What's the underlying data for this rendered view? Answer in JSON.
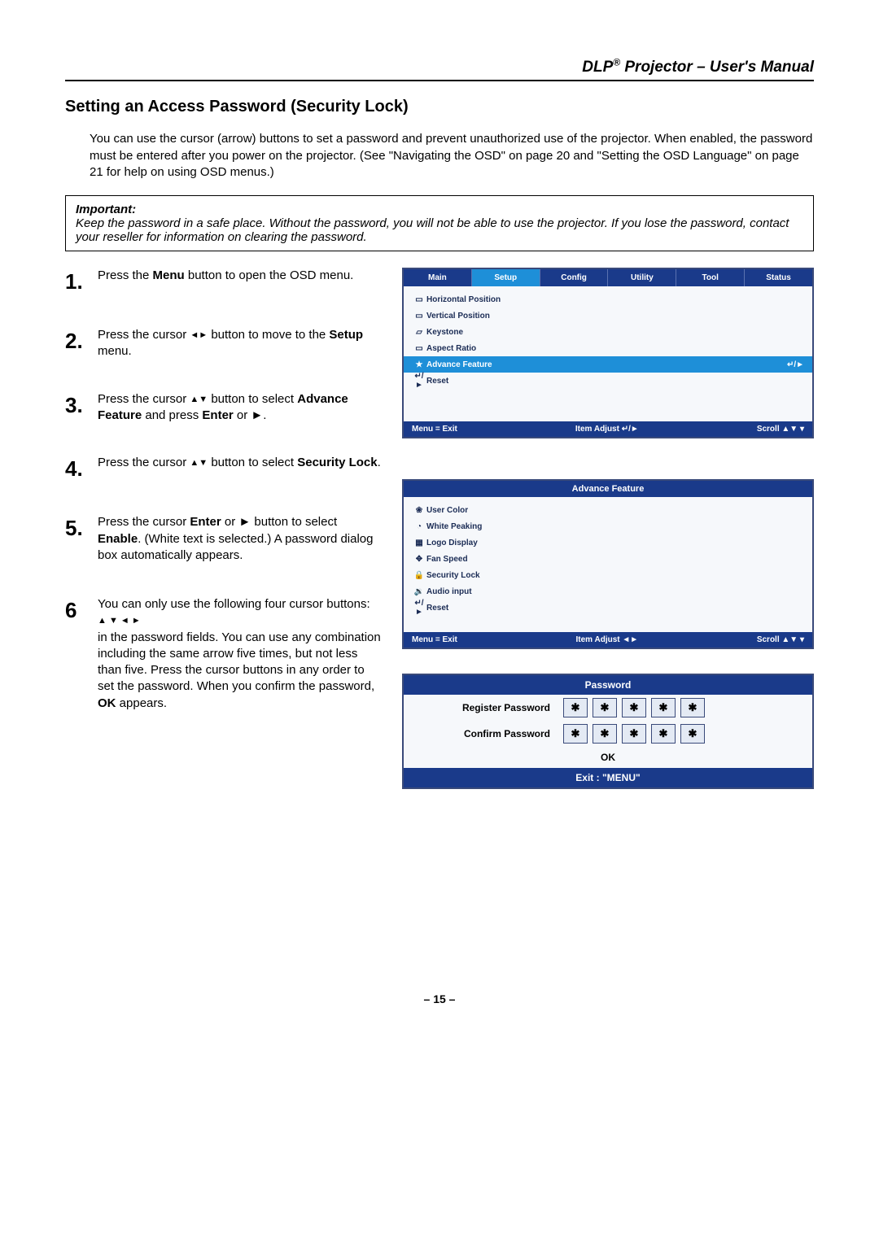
{
  "header": {
    "title_prefix": "DLP",
    "title_suffix": " Projector – User's Manual"
  },
  "section_title": "Setting an Access Password (Security Lock)",
  "intro": "You can use the cursor (arrow) buttons to set a password and prevent unauthorized use of the projector. When enabled, the password must be entered after you power on the projector. (See \"Navigating the OSD\" on page 20 and \"Setting the OSD Language\" on page 21 for help on using OSD menus.)",
  "important": {
    "label": "Important:",
    "body": "Keep the password in a safe place. Without the password, you will not be able to use the projector. If you lose the password, contact your reseller for information on clearing the password."
  },
  "steps": [
    {
      "num": "1.",
      "text_a": "Press the ",
      "b1": "Menu",
      "text_b": " button to open the OSD menu."
    },
    {
      "num": "2.",
      "text_a": "Press the cursor ",
      "arrows": "◄►",
      "text_b": " button to move to the ",
      "b1": "Setup",
      "text_c": " menu."
    },
    {
      "num": "3.",
      "text_a": "Press the cursor ",
      "arrows": "▲▼",
      "text_b": " button to select ",
      "b1": "Advance Feature",
      "text_c": " and press ",
      "b2": "Enter",
      "text_d": " or ►."
    },
    {
      "num": "4.",
      "text_a": "Press the cursor ",
      "arrows": "▲▼",
      "text_b": " button to select ",
      "b1": "Security Lock",
      "text_c": "."
    },
    {
      "num": "5.",
      "text_a": "Press the cursor ",
      "b1": "Enter",
      "text_b": " or ► button to select ",
      "b2": "Enable",
      "text_c": ". (White text is selected.) A password dialog box automatically appears."
    },
    {
      "num": "6",
      "text_a": "You can only use the following four cursor buttons: ",
      "arrows": "▲ ▼ ◄ ►",
      "text_b": " in the password fields. You can use any combination including the same arrow five times, but not less than five. Press the cursor buttons in any order to set the password. When you confirm the password, ",
      "b1": "OK",
      "text_c": " appears."
    }
  ],
  "osd1": {
    "tabs": [
      "Main",
      "Setup",
      "Config",
      "Utility",
      "Tool",
      "Status"
    ],
    "selected_tab": "Setup",
    "items": [
      {
        "icon": "▭",
        "label": "Horizontal Position"
      },
      {
        "icon": "▭",
        "label": "Vertical Position"
      },
      {
        "icon": "▱",
        "label": "Keystone"
      },
      {
        "icon": "▭",
        "label": "Aspect Ratio"
      },
      {
        "icon": "★",
        "label": "Advance Feature",
        "highlight": true,
        "extra": "↵/►"
      },
      {
        "icon": "↵/►",
        "label": "Reset"
      }
    ],
    "footer_left": "Menu = Exit",
    "footer_mid": "Item Adjust  ↵/►",
    "footer_right": "Scroll  ▲▼  ▾"
  },
  "osd2": {
    "title": "Advance Feature",
    "items": [
      {
        "icon": "❀",
        "label": "User Color"
      },
      {
        "icon": "◔",
        "label": "White Peaking"
      },
      {
        "icon": "▦",
        "label": "Logo Display"
      },
      {
        "icon": "✥",
        "label": "Fan Speed"
      },
      {
        "icon": "🔒",
        "label": "Security Lock"
      },
      {
        "icon": "🔉",
        "label": "Audio input"
      },
      {
        "icon": "↵/►",
        "label": "Reset"
      }
    ],
    "footer_left": "Menu = Exit",
    "footer_mid": "Item Adjust  ◄►",
    "footer_right": "Scroll  ▲▼  ▾"
  },
  "password_dialog": {
    "title": "Password",
    "register": "Register Password",
    "confirm": "Confirm Password",
    "mask": "✱",
    "ok": "OK",
    "exit": "Exit  :  \"MENU\""
  },
  "page_number": "– 15 –"
}
